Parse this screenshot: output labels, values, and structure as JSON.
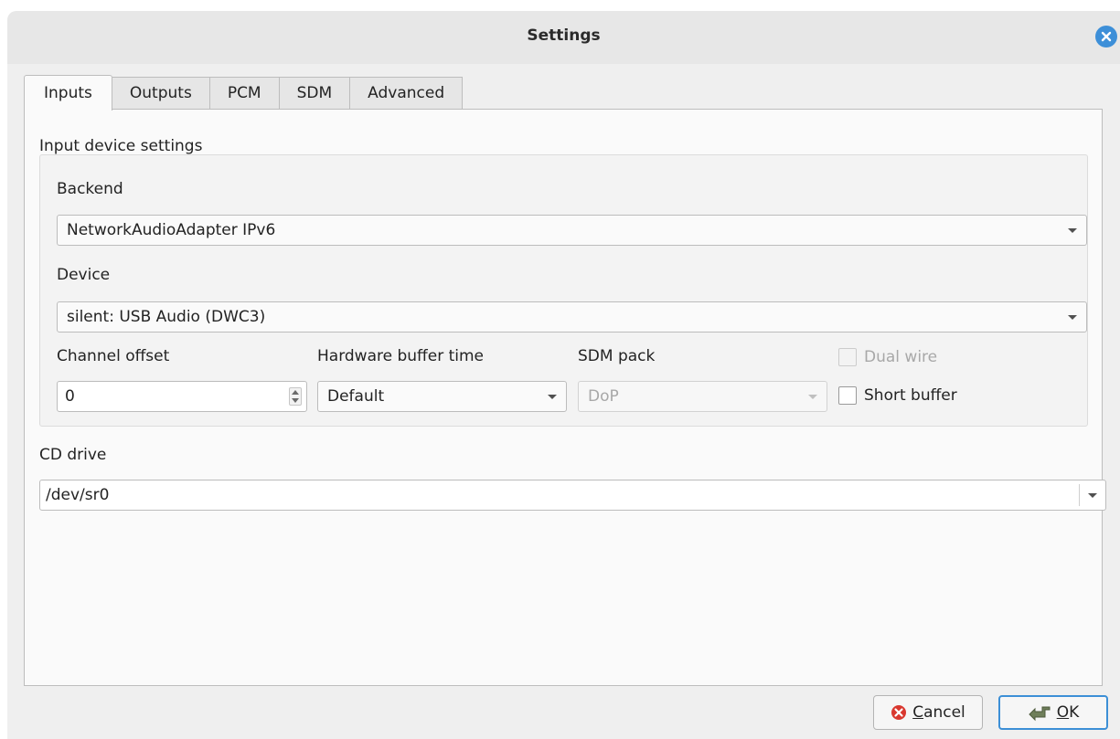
{
  "window": {
    "title": "Settings"
  },
  "tabs": [
    {
      "label": "Inputs",
      "active": true
    },
    {
      "label": "Outputs",
      "active": false
    },
    {
      "label": "PCM",
      "active": false
    },
    {
      "label": "SDM",
      "active": false
    },
    {
      "label": "Advanced",
      "active": false
    }
  ],
  "input_group": {
    "title": "Input device settings",
    "backend_label": "Backend",
    "backend_value": "NetworkAudioAdapter IPv6",
    "device_label": "Device",
    "device_value": "silent: USB Audio (DWC3)",
    "channel_offset_label": "Channel offset",
    "channel_offset_value": "0",
    "buffer_time_label": "Hardware buffer time",
    "buffer_time_value": "Default",
    "sdm_pack_label": "SDM pack",
    "sdm_pack_value": "DoP",
    "dual_wire_label": "Dual wire",
    "dual_wire_checked": false,
    "dual_wire_enabled": false,
    "short_buffer_label": "Short buffer",
    "short_buffer_checked": false
  },
  "cd_drive": {
    "label": "CD drive",
    "value": "/dev/sr0"
  },
  "buttons": {
    "cancel_label": "Cancel",
    "cancel_mnemonic": "C",
    "ok_label": "OK",
    "ok_mnemonic": "O"
  },
  "colors": {
    "accent": "#3d8fd8",
    "cancel_icon": "#d9382f"
  }
}
